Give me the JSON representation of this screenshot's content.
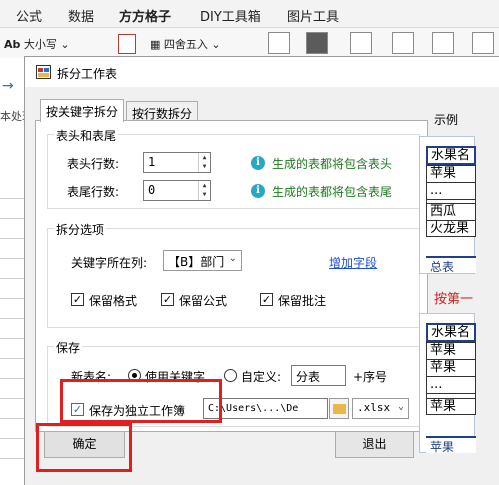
{
  "ribbon": {
    "tabs": [
      "公式",
      "数据",
      "方方格子",
      "DIY工具箱",
      "图片工具"
    ],
    "tools": {
      "text_case": "大小写",
      "round": "四舍五入"
    },
    "left_strip_text": "本处现"
  },
  "dialog": {
    "title": "拆分工作表",
    "tabs": [
      "按关键字拆分",
      "按行数拆分"
    ],
    "header_footer": {
      "group_title": "表头和表尾",
      "header_rows_label": "表头行数:",
      "header_rows_value": "1",
      "header_hint": "生成的表都将包含表头",
      "footer_rows_label": "表尾行数:",
      "footer_rows_value": "0",
      "footer_hint": "生成的表都将包含表尾"
    },
    "split_options": {
      "group_title": "拆分选项",
      "key_column_label": "关键字所在列:",
      "key_column_value": "【B】部门",
      "add_field_link": "增加字段",
      "keep_format": "保留格式",
      "keep_formula": "保留公式",
      "keep_comment": "保留批注"
    },
    "save": {
      "group_title": "保存",
      "new_name_label": "新表名:",
      "use_keyword": "使用关键字",
      "custom_label": "自定义:",
      "custom_value": "分表",
      "seq_suffix": "+序号",
      "save_separate_workbook": "保存为独立工作簿",
      "path_value": "C:\\Users\\...\\De",
      "extension_value": ".xlsx"
    },
    "ok_label": "确定",
    "exit_label": "退出",
    "example_title": "示例",
    "example_summary": {
      "header": "水果名",
      "rows": [
        "苹果",
        "...",
        "西瓜",
        "火龙果"
      ],
      "sheet_tab": "总表"
    },
    "example_note": "按第一",
    "example_split": {
      "header": "水果名",
      "rows": [
        "苹果",
        "苹果",
        "...",
        "苹果"
      ],
      "sheet_tab": "苹果"
    }
  },
  "colors": {
    "highlight": "#e02020",
    "hint_text": "#1d7a1d",
    "link": "#1a4fd6"
  }
}
